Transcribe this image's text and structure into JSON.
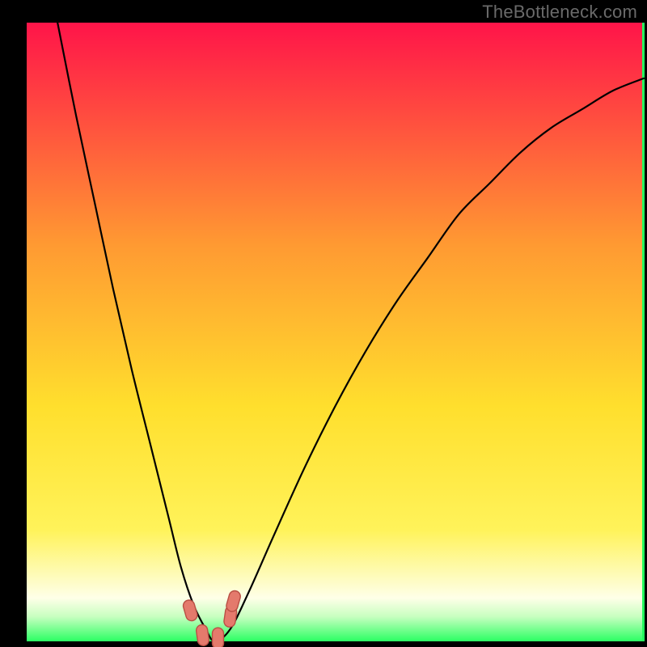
{
  "watermark": "TheBottleneck.com",
  "colors": {
    "black": "#000000",
    "grad_top": "#ff1449",
    "grad_mid_upper": "#ff7a32",
    "grad_mid": "#ffcf2d",
    "grad_lower": "#fff35a",
    "grad_pale": "#fdffe0",
    "grad_green": "#2bff63",
    "curve": "#000000",
    "marker_fill": "#e47a6c",
    "marker_stroke": "#b94f44"
  },
  "chart_data": {
    "type": "line",
    "title": "",
    "xlabel": "",
    "ylabel": "",
    "xlim": [
      0,
      100
    ],
    "ylim": [
      0,
      100
    ],
    "series": [
      {
        "name": "bottleneck-curve",
        "x": [
          5,
          8,
          11,
          14,
          17,
          20,
          23,
          25,
          27,
          29,
          30.5,
          33,
          36,
          40,
          45,
          50,
          55,
          60,
          65,
          70,
          75,
          80,
          85,
          90,
          95,
          100
        ],
        "y": [
          100,
          85,
          71,
          57,
          44,
          32,
          20,
          12,
          6,
          2,
          0,
          2,
          8,
          17,
          28,
          38,
          47,
          55,
          62,
          69,
          74,
          79,
          83,
          86,
          89,
          91
        ]
      }
    ],
    "markers": [
      {
        "x": 26.5,
        "y": 5.0
      },
      {
        "x": 28.5,
        "y": 1.0
      },
      {
        "x": 31.0,
        "y": 0.5
      },
      {
        "x": 33.0,
        "y": 4.0
      },
      {
        "x": 33.5,
        "y": 6.5
      }
    ],
    "gradient_stops_percent": [
      {
        "pos": 0,
        "value_pct": 100
      },
      {
        "pos": 36,
        "value_pct": 64
      },
      {
        "pos": 62,
        "value_pct": 38
      },
      {
        "pos": 82,
        "value_pct": 18
      },
      {
        "pos": 94,
        "value_pct": 6
      },
      {
        "pos": 100,
        "value_pct": 0
      }
    ]
  }
}
